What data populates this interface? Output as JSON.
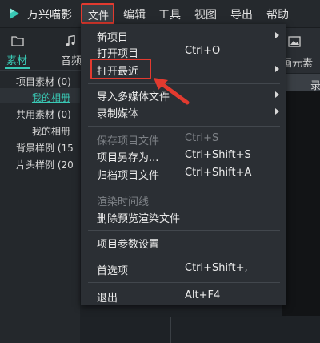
{
  "app": {
    "title": "万兴喵影"
  },
  "menubar": {
    "file": "文件",
    "edit": "编辑",
    "tools": "工具",
    "view": "视图",
    "export": "导出",
    "help": "帮助"
  },
  "library": {
    "tabs": [
      {
        "label": "素材",
        "icon": "folder-icon"
      },
      {
        "label": "音频",
        "icon": "music-note-icon"
      }
    ],
    "tree": {
      "project_materials": "项目素材 (0)",
      "my_album_1": "我的相册",
      "shared_materials": "共用素材 (0)",
      "my_album_2": "我的相册",
      "bg_samples": "背景样例 (15",
      "intro_samples": "片头样例 (20"
    }
  },
  "right_panel": {
    "tab_label": "画元素",
    "tab_icon": "image-icon",
    "bar_label": "录"
  },
  "file_menu": {
    "new_project": "新项目",
    "open_project": "打开项目",
    "open_project_shortcut": "Ctrl+O",
    "open_recent": "打开最近",
    "import_media": "导入多媒体文件",
    "record_media": "录制媒体",
    "save_project": "保存项目文件",
    "save_project_shortcut": "Ctrl+S",
    "save_as": "项目另存为...",
    "save_as_shortcut": "Ctrl+Shift+S",
    "archive": "归档项目文件",
    "archive_shortcut": "Ctrl+Shift+A",
    "render_timeline": "渲染时间线",
    "delete_preview": "删除预览渲染文件",
    "project_settings": "项目参数设置",
    "preferences": "首选项",
    "preferences_shortcut": "Ctrl+Shift+,",
    "exit": "退出",
    "exit_shortcut": "Alt+F4"
  },
  "colors": {
    "accent": "#39c9b5",
    "highlight": "#e23a2f",
    "menu_bg": "#2b2f34"
  }
}
